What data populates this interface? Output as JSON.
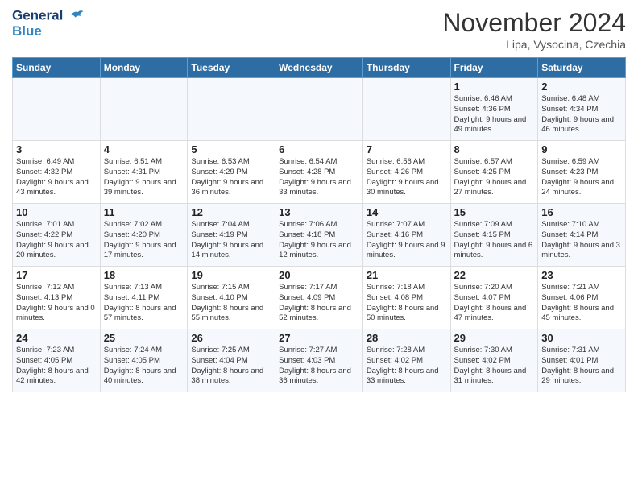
{
  "header": {
    "logo_line1": "General",
    "logo_line2": "Blue",
    "month_title": "November 2024",
    "location": "Lipa, Vysocina, Czechia"
  },
  "weekdays": [
    "Sunday",
    "Monday",
    "Tuesday",
    "Wednesday",
    "Thursday",
    "Friday",
    "Saturday"
  ],
  "weeks": [
    [
      {
        "day": "",
        "info": ""
      },
      {
        "day": "",
        "info": ""
      },
      {
        "day": "",
        "info": ""
      },
      {
        "day": "",
        "info": ""
      },
      {
        "day": "",
        "info": ""
      },
      {
        "day": "1",
        "info": "Sunrise: 6:46 AM\nSunset: 4:36 PM\nDaylight: 9 hours\nand 49 minutes."
      },
      {
        "day": "2",
        "info": "Sunrise: 6:48 AM\nSunset: 4:34 PM\nDaylight: 9 hours\nand 46 minutes."
      }
    ],
    [
      {
        "day": "3",
        "info": "Sunrise: 6:49 AM\nSunset: 4:32 PM\nDaylight: 9 hours\nand 43 minutes."
      },
      {
        "day": "4",
        "info": "Sunrise: 6:51 AM\nSunset: 4:31 PM\nDaylight: 9 hours\nand 39 minutes."
      },
      {
        "day": "5",
        "info": "Sunrise: 6:53 AM\nSunset: 4:29 PM\nDaylight: 9 hours\nand 36 minutes."
      },
      {
        "day": "6",
        "info": "Sunrise: 6:54 AM\nSunset: 4:28 PM\nDaylight: 9 hours\nand 33 minutes."
      },
      {
        "day": "7",
        "info": "Sunrise: 6:56 AM\nSunset: 4:26 PM\nDaylight: 9 hours\nand 30 minutes."
      },
      {
        "day": "8",
        "info": "Sunrise: 6:57 AM\nSunset: 4:25 PM\nDaylight: 9 hours\nand 27 minutes."
      },
      {
        "day": "9",
        "info": "Sunrise: 6:59 AM\nSunset: 4:23 PM\nDaylight: 9 hours\nand 24 minutes."
      }
    ],
    [
      {
        "day": "10",
        "info": "Sunrise: 7:01 AM\nSunset: 4:22 PM\nDaylight: 9 hours\nand 20 minutes."
      },
      {
        "day": "11",
        "info": "Sunrise: 7:02 AM\nSunset: 4:20 PM\nDaylight: 9 hours\nand 17 minutes."
      },
      {
        "day": "12",
        "info": "Sunrise: 7:04 AM\nSunset: 4:19 PM\nDaylight: 9 hours\nand 14 minutes."
      },
      {
        "day": "13",
        "info": "Sunrise: 7:06 AM\nSunset: 4:18 PM\nDaylight: 9 hours\nand 12 minutes."
      },
      {
        "day": "14",
        "info": "Sunrise: 7:07 AM\nSunset: 4:16 PM\nDaylight: 9 hours\nand 9 minutes."
      },
      {
        "day": "15",
        "info": "Sunrise: 7:09 AM\nSunset: 4:15 PM\nDaylight: 9 hours\nand 6 minutes."
      },
      {
        "day": "16",
        "info": "Sunrise: 7:10 AM\nSunset: 4:14 PM\nDaylight: 9 hours\nand 3 minutes."
      }
    ],
    [
      {
        "day": "17",
        "info": "Sunrise: 7:12 AM\nSunset: 4:13 PM\nDaylight: 9 hours\nand 0 minutes."
      },
      {
        "day": "18",
        "info": "Sunrise: 7:13 AM\nSunset: 4:11 PM\nDaylight: 8 hours\nand 57 minutes."
      },
      {
        "day": "19",
        "info": "Sunrise: 7:15 AM\nSunset: 4:10 PM\nDaylight: 8 hours\nand 55 minutes."
      },
      {
        "day": "20",
        "info": "Sunrise: 7:17 AM\nSunset: 4:09 PM\nDaylight: 8 hours\nand 52 minutes."
      },
      {
        "day": "21",
        "info": "Sunrise: 7:18 AM\nSunset: 4:08 PM\nDaylight: 8 hours\nand 50 minutes."
      },
      {
        "day": "22",
        "info": "Sunrise: 7:20 AM\nSunset: 4:07 PM\nDaylight: 8 hours\nand 47 minutes."
      },
      {
        "day": "23",
        "info": "Sunrise: 7:21 AM\nSunset: 4:06 PM\nDaylight: 8 hours\nand 45 minutes."
      }
    ],
    [
      {
        "day": "24",
        "info": "Sunrise: 7:23 AM\nSunset: 4:05 PM\nDaylight: 8 hours\nand 42 minutes."
      },
      {
        "day": "25",
        "info": "Sunrise: 7:24 AM\nSunset: 4:05 PM\nDaylight: 8 hours\nand 40 minutes."
      },
      {
        "day": "26",
        "info": "Sunrise: 7:25 AM\nSunset: 4:04 PM\nDaylight: 8 hours\nand 38 minutes."
      },
      {
        "day": "27",
        "info": "Sunrise: 7:27 AM\nSunset: 4:03 PM\nDaylight: 8 hours\nand 36 minutes."
      },
      {
        "day": "28",
        "info": "Sunrise: 7:28 AM\nSunset: 4:02 PM\nDaylight: 8 hours\nand 33 minutes."
      },
      {
        "day": "29",
        "info": "Sunrise: 7:30 AM\nSunset: 4:02 PM\nDaylight: 8 hours\nand 31 minutes."
      },
      {
        "day": "30",
        "info": "Sunrise: 7:31 AM\nSunset: 4:01 PM\nDaylight: 8 hours\nand 29 minutes."
      }
    ]
  ]
}
